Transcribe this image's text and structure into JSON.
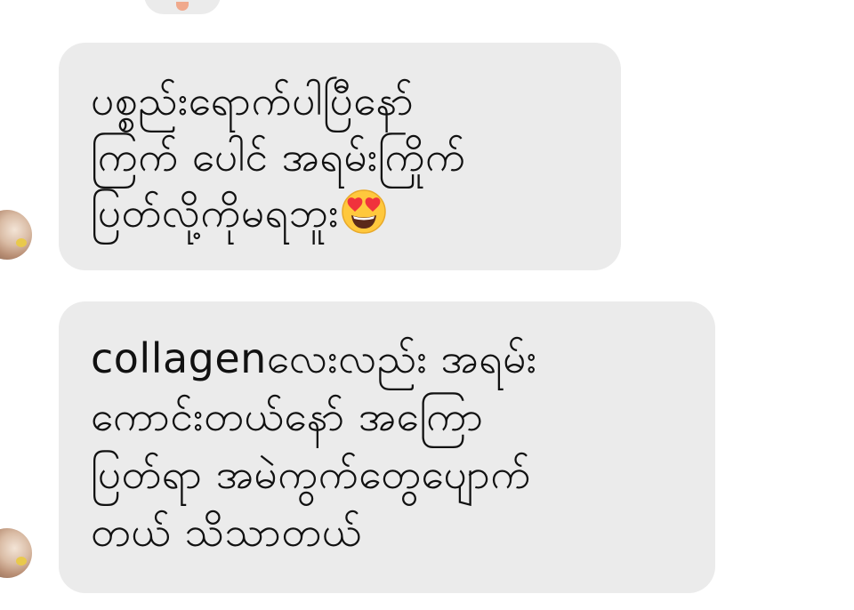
{
  "conversation": {
    "messages": [
      {
        "lines": [
          "ပစ္စည်းရောက်ပါပြီနော်",
          "ကြက် ပေါင် အရမ်းကြိုက်",
          "ပြတ်လို့ကိုမရဘူး"
        ],
        "trailing_emoji": "heart-eyes-emoji"
      },
      {
        "lines": [
          "collagenလေးလည်း အရမ်း",
          "ကောင်းတယ်နော် အကြော",
          "ပြတ်ရာ အမဲကွက်တွေပျောက်",
          "တယ် သိသာတယ်"
        ]
      }
    ]
  },
  "colors": {
    "bubble_bg": "#ebebeb",
    "text": "#111111",
    "emoji_face": "#ffc83d",
    "emoji_heart": "#f0323c"
  }
}
